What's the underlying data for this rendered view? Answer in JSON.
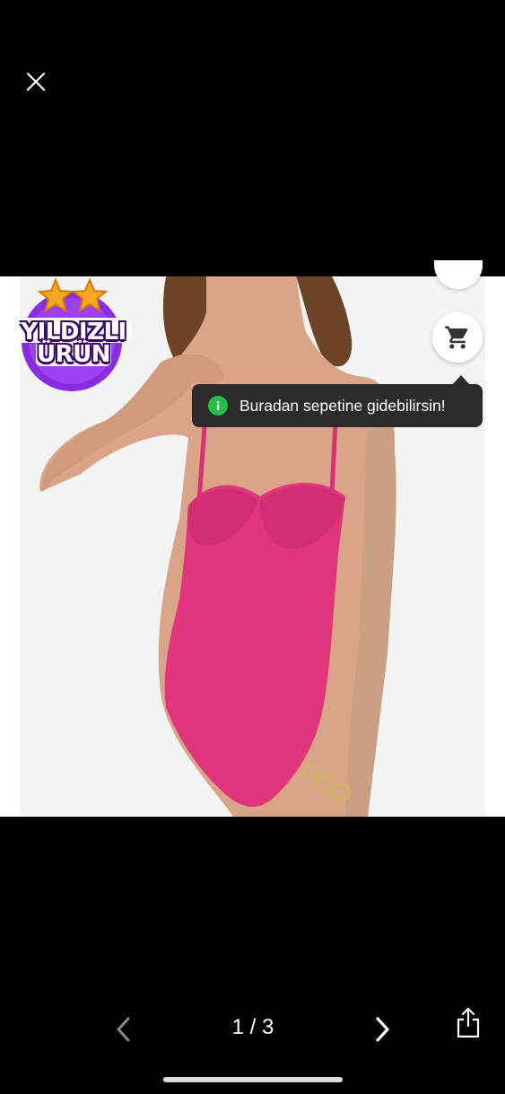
{
  "viewer": {
    "close_label": "Close",
    "page_indicator": "1 / 3"
  },
  "badge": {
    "line1": "YILDIZLI",
    "line2": "ÜRÜN",
    "star_color": "#f5a623",
    "circle_color": "#8a2be2"
  },
  "tooltip": {
    "text": "Buradan sepetine gidebilirsin!",
    "icon": "info-icon"
  },
  "cart": {
    "icon": "cart-icon"
  },
  "product_image": {
    "subject": "pink swimsuit",
    "swimsuit_color": "#e0357a"
  },
  "icons": {
    "close": "close-icon",
    "prev": "chevron-left-icon",
    "next": "chevron-right-icon",
    "share": "share-icon"
  }
}
